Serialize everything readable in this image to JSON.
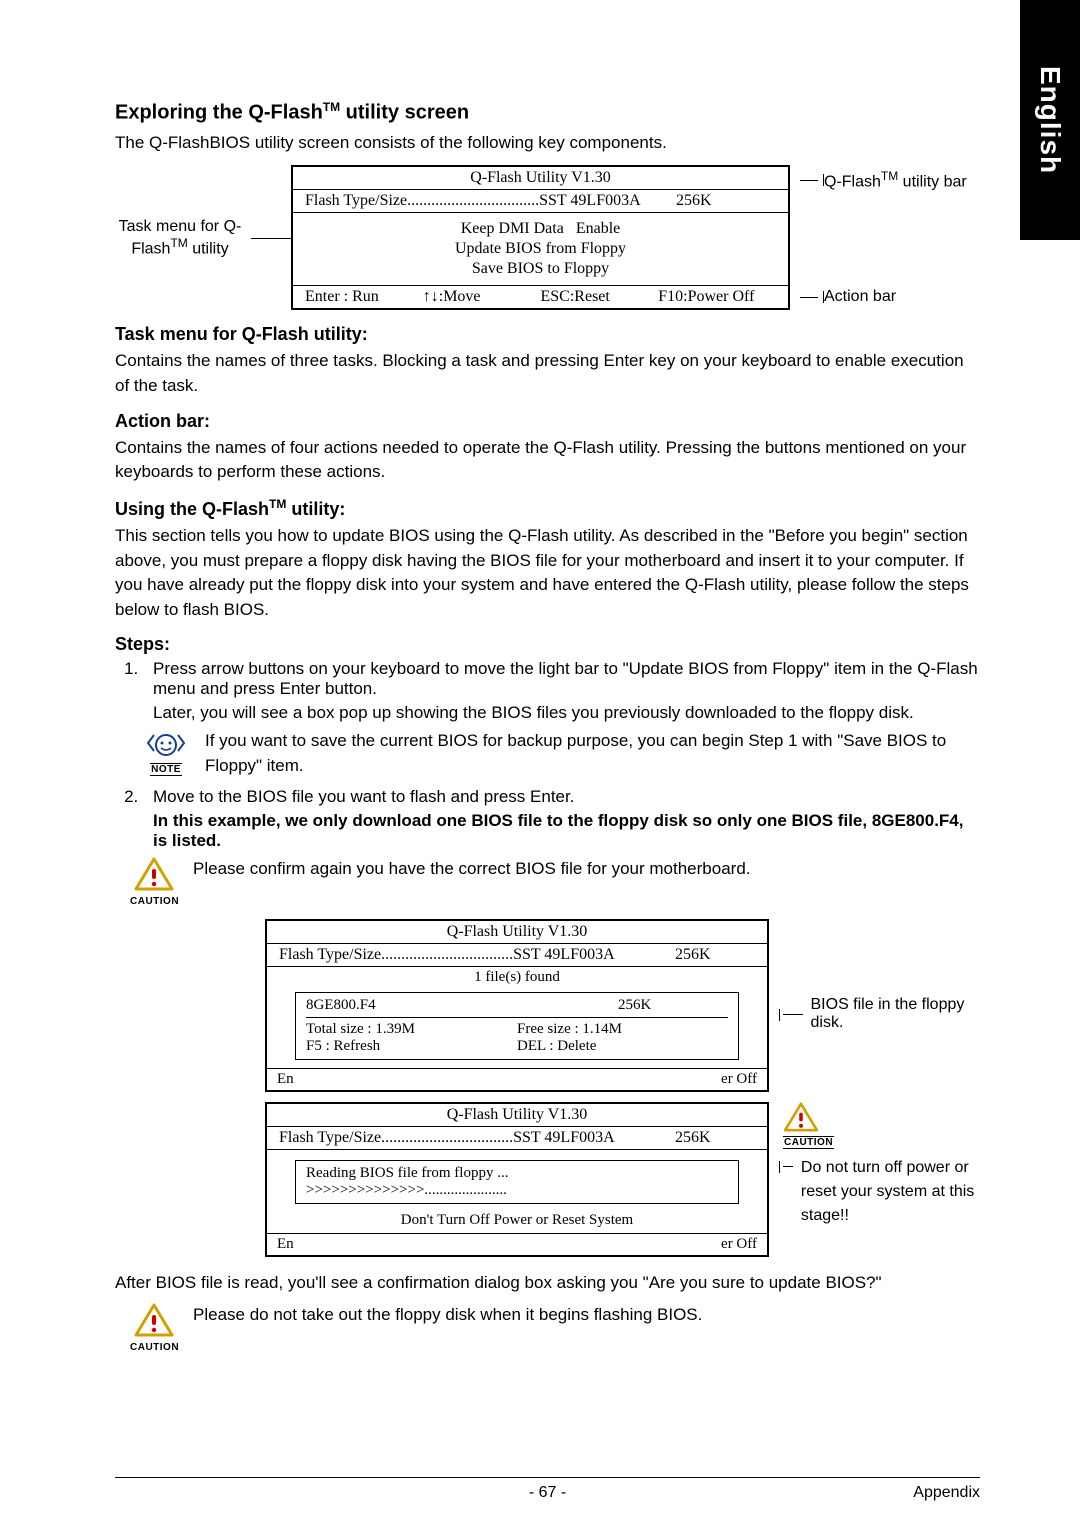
{
  "side_tab": "English",
  "title1": "Exploring the Q-Flash",
  "title1_suffix": " utility screen",
  "intro1": "The Q-FlashBIOS utility screen consists of the following key components.",
  "labels": {
    "task_menu": "Task menu for Q-Flash",
    "task_menu2": " utility",
    "utility_bar": "Q-Flash",
    "utility_bar2": " utility bar",
    "action_bar": "Action bar"
  },
  "bios1": {
    "title": "Q-Flash Utility V1.30",
    "flash_label": "Flash Type/Size.................................SST 49LF003A",
    "size": "256K",
    "task1a": "Keep DMI Data",
    "task1b": "Enable",
    "task2": "Update BIOS from Floppy",
    "task3": "Save BIOS to Floppy",
    "a1": "Enter : Run",
    "a2": "↑↓:Move",
    "a3": "ESC:Reset",
    "a4": "F10:Power Off"
  },
  "sec_task_h": "Task menu for Q-Flash utility:",
  "sec_task_p": "Contains the names of three tasks. Blocking a task and pressing Enter key on your keyboard to enable execution of the task.",
  "sec_action_h": "Action bar:",
  "sec_action_p": "Contains the names of four actions needed to operate the Q-Flash utility. Pressing the buttons mentioned on your keyboards to perform these actions.",
  "sec_using_h_a": "Using the Q-Flash",
  "sec_using_h_b": " utility:",
  "sec_using_p": "This section tells you how to update BIOS using the Q-Flash utility. As described in the \"Before you begin\" section above, you must prepare a floppy disk having the BIOS file for your motherboard and insert it to your computer. If you have already put the floppy disk into your system and have entered the Q-Flash utility, please follow the steps below to flash BIOS.",
  "steps_h": "Steps:",
  "step1a": "Press arrow buttons on your keyboard to move the light bar to \"Update BIOS from Floppy\" item in the Q-Flash menu and press Enter button.",
  "step1b": "Later, you will see a box pop up showing the BIOS files you previously downloaded to the floppy disk.",
  "note1": "If you want to save the current BIOS for backup purpose, you can begin Step 1 with \"Save BIOS to Floppy\" item.",
  "step2a": "Move to the BIOS file you want to flash and press Enter.",
  "step2b": "In this example, we only download one BIOS file to the floppy disk so only one BIOS file, 8GE800.F4, is listed.",
  "caution1": "Please confirm again you have the correct BIOS file for your motherboard.",
  "bios2": {
    "title": "Q-Flash Utility V1.30",
    "flash_label": "Flash Type/Size.................................SST 49LF003A",
    "size": "256K",
    "found": "1 file(s) found",
    "file": "8GE800.F4",
    "file_size": "256K",
    "total": "Total size : 1.39M",
    "free": "Free size : 1.14M",
    "f5": "F5 : Refresh",
    "del": "DEL : Delete",
    "bg_l": "En",
    "bg_r": "er Off"
  },
  "anno2": "BIOS file in the floppy disk.",
  "bios3": {
    "title": "Q-Flash Utility V1.30",
    "flash_label": "Flash Type/Size.................................SST 49LF003A",
    "size": "256K",
    "reading": "Reading BIOS file from floppy ...",
    "progress": ">>>>>>>>>>>>>>......................",
    "warning": "Don't Turn Off Power or Reset System",
    "bg_l": "En",
    "bg_r": "er Off"
  },
  "anno3": "Do not turn off power or reset your system at this stage!!",
  "after_read": "After BIOS file is read, you'll see a confirmation dialog box asking you \"Are you sure to update BIOS?\"",
  "caution2": "Please do not take out the floppy disk when it begins flashing BIOS.",
  "footer": {
    "page": "- 67 -",
    "section": "Appendix"
  },
  "icon_labels": {
    "note": "NOTE",
    "caution": "CAUTION"
  },
  "tm": "TM"
}
